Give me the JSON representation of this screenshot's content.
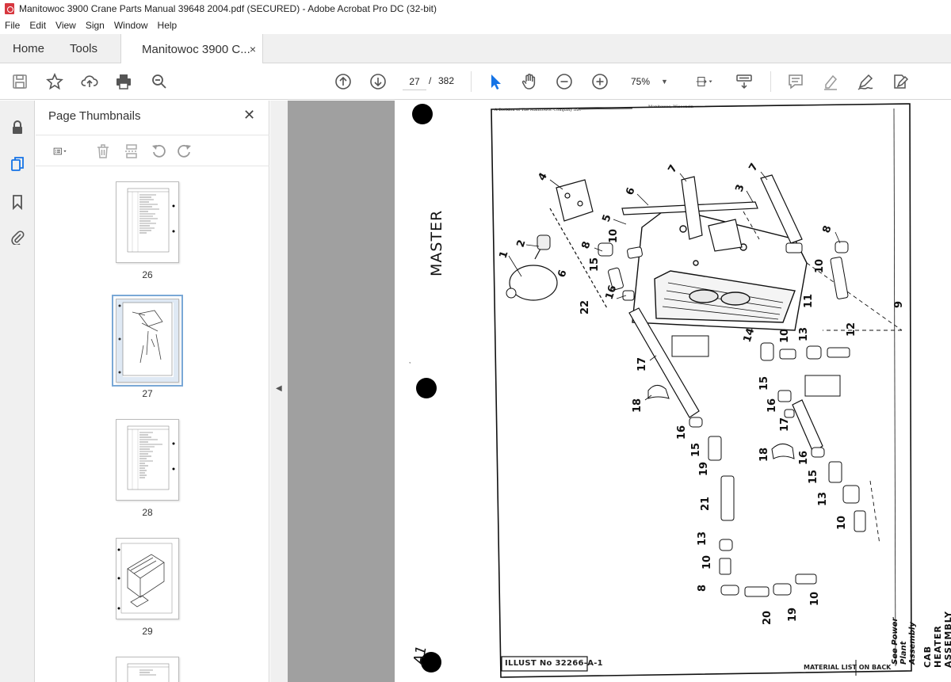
{
  "window": {
    "title": "Manitowoc 3900 Crane Parts Manual 39648 2004.pdf (SECURED) - Adobe Acrobat Pro DC (32-bit)"
  },
  "menu": [
    "File",
    "Edit",
    "View",
    "Sign",
    "Window",
    "Help"
  ],
  "tabs": {
    "home": "Home",
    "tools": "Tools",
    "document": "Manitowoc 3900 C...",
    "close": "×"
  },
  "toolbar": {
    "current_page": "27",
    "separator": "/",
    "total_pages": "382",
    "zoom": "75%",
    "zoom_caret": "▼"
  },
  "panel": {
    "title": "Page Thumbnails",
    "close": "✕",
    "collapse_arrow": "◀",
    "scroll_up": "▲",
    "scroll_down": "▼"
  },
  "thumbnails": [
    {
      "label": "26"
    },
    {
      "label": "27",
      "selected": true
    },
    {
      "label": "28"
    },
    {
      "label": "29"
    }
  ],
  "document": {
    "header_left": "A Division of The Manitowoc Company Inc.",
    "header_right": "Manitowoc, Wisconsin",
    "stamp": "MASTER",
    "title_vertical": "CAB HEATER ASSEMBLY",
    "see_note": "See Power Plant Assembly",
    "illust": "ILLUST No 32266-A-1",
    "material_list": "MATERIAL LIST ON BACK",
    "margin_note": "A1",
    "callouts": [
      "1",
      "2",
      "3",
      "4",
      "5",
      "6",
      "6",
      "7",
      "7",
      "8",
      "8",
      "8",
      "9",
      "10",
      "10",
      "10",
      "10",
      "10",
      "10",
      "11",
      "12",
      "13",
      "13",
      "13",
      "14",
      "15",
      "15",
      "15",
      "15",
      "16",
      "16",
      "16",
      "16",
      "17",
      "17",
      "18",
      "18",
      "19",
      "19",
      "20",
      "21",
      "22"
    ]
  },
  "colors": {
    "accent": "#1473e6",
    "page_bg": "#a0a0a0",
    "chrome": "#f0f0f0"
  }
}
